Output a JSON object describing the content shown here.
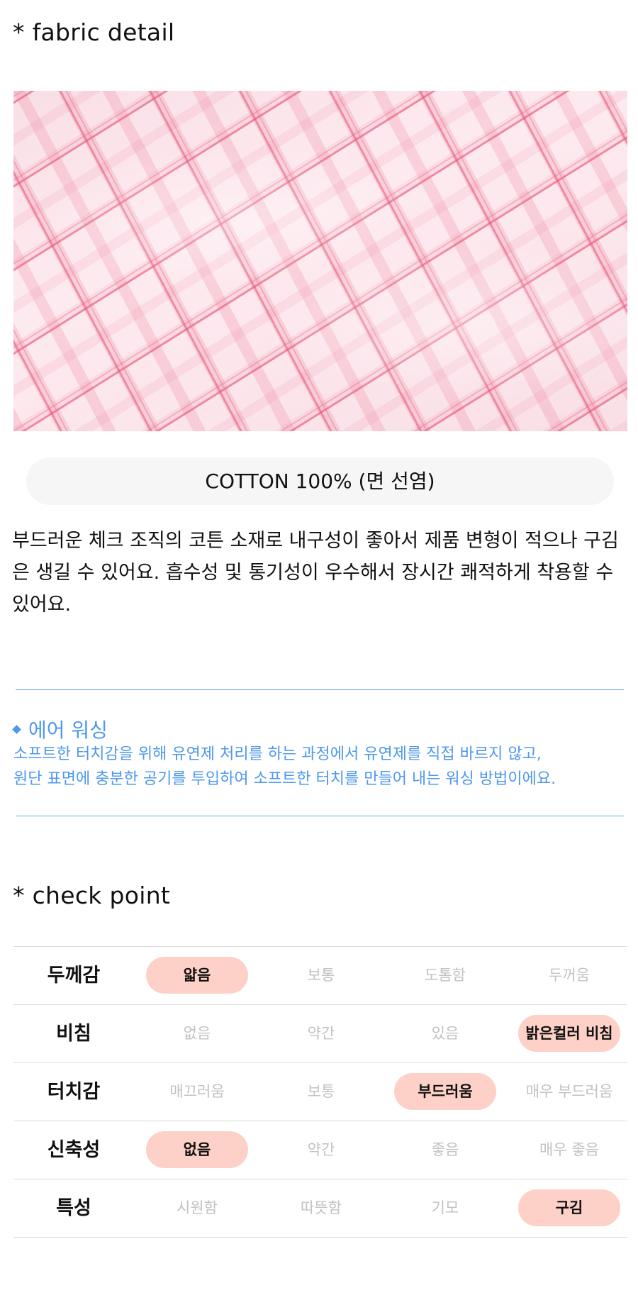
{
  "fabric_section": {
    "title": "* fabric detail",
    "photo_icon": "pink-check-fabric-photo",
    "material": "COTTON 100% (면 선염)",
    "description": "부드러운 체크 조직의 코튼 소재로 내구성이 좋아서 제품 변형이 적으나 구김은 생길 수 있어요. 흡수성 및 통기성이 우수해서 장시간 쾌적하게 착용할 수 있어요."
  },
  "air_washing": {
    "title": "에어 워싱",
    "line1": "소프트한 터치감을 위해 유연제 처리를 하는 과정에서 유연제를 직접 바르지 않고,",
    "line2": "원단 표면에 충분한 공기를 투입하여 소프트한 터치를 만들어 내는 워싱 방법이에요."
  },
  "check_point": {
    "title": "* check point",
    "rows": [
      {
        "label": "두께감",
        "options": [
          "얇음",
          "보통",
          "도톰함",
          "두꺼움"
        ],
        "selected": 0
      },
      {
        "label": "비침",
        "options": [
          "없음",
          "약간",
          "있음",
          "밝은컬러 비침"
        ],
        "selected": 3
      },
      {
        "label": "터치감",
        "options": [
          "매끄러움",
          "보통",
          "부드러움",
          "매우 부드러움"
        ],
        "selected": 2
      },
      {
        "label": "신축성",
        "options": [
          "없음",
          "약간",
          "좋음",
          "매우 좋음"
        ],
        "selected": 0
      },
      {
        "label": "특성",
        "options": [
          "시원함",
          "따뜻함",
          "기모",
          "구김"
        ],
        "selected": 3
      }
    ]
  },
  "colors": {
    "accent_blue": "#4e98ec",
    "selected_pill": "#fdd1c7",
    "unselected_text": "#c2c2c2"
  }
}
